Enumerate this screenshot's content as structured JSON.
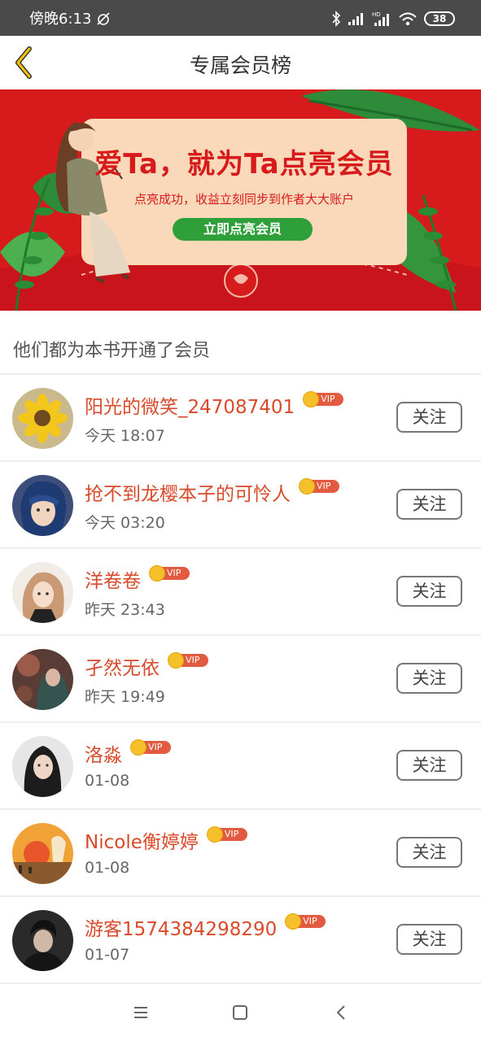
{
  "status_bar": {
    "time": "傍晚6:13",
    "battery": "38",
    "icons": [
      "alarm-off-icon",
      "bluetooth-icon",
      "signal-icon",
      "hd-signal-icon",
      "wifi-icon",
      "battery-icon"
    ]
  },
  "header": {
    "title": "专属会员榜",
    "back_icon": "back-arrow-icon"
  },
  "banner": {
    "title": "爱Ta，就为Ta点亮会员",
    "subtitle": "点亮成功，收益立刻同步到作者大大账户",
    "button_label": "立即点亮会员"
  },
  "section": {
    "title": "他们都为本书开通了会员"
  },
  "members": [
    {
      "name": "阳光的微笑_247087401",
      "time": "今天 18:07",
      "vip": "VIP",
      "follow": "关注"
    },
    {
      "name": "抢不到龙樱本子的可怜人",
      "time": "今天 03:20",
      "vip": "VIP",
      "follow": "关注"
    },
    {
      "name": "洋卷卷",
      "time": "昨天 23:43",
      "vip": "VIP",
      "follow": "关注"
    },
    {
      "name": "孑然无依",
      "time": "昨天 19:49",
      "vip": "VIP",
      "follow": "关注"
    },
    {
      "name": "洛淼",
      "time": "01-08",
      "vip": "VIP",
      "follow": "关注"
    },
    {
      "name": "Nicole衡婷婷",
      "time": "01-08",
      "vip": "VIP",
      "follow": "关注"
    },
    {
      "name": "游客1574384298290",
      "time": "01-07",
      "vip": "VIP",
      "follow": "关注"
    }
  ],
  "nav_bar": {
    "icons": [
      "menu-icon",
      "home-square-icon",
      "back-triangle-icon"
    ]
  },
  "colors": {
    "accent": "#d94a2b",
    "banner_red": "#d71a1c",
    "banner_green": "#2f9f3a",
    "vip_gold": "#f6c02a",
    "back_arrow": "#e6b400"
  }
}
